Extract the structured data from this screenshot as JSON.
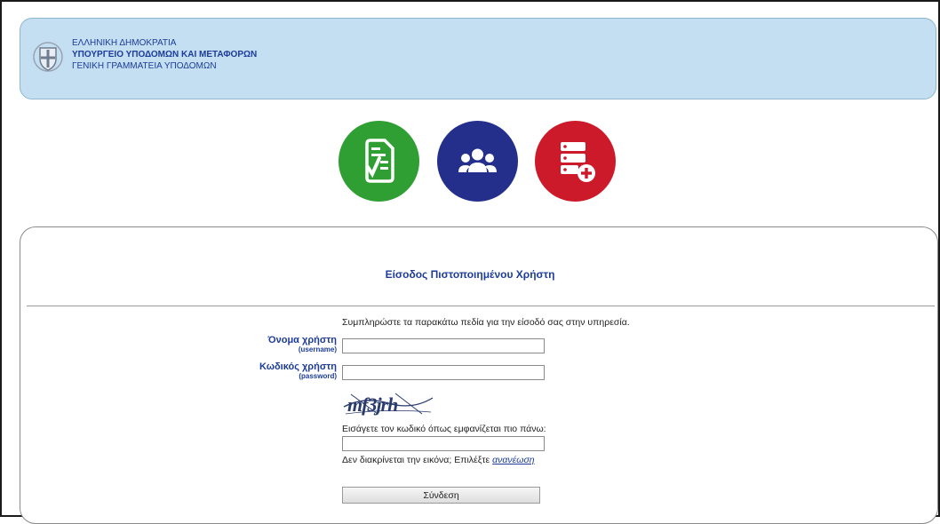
{
  "header": {
    "line1": "ΕΛΛΗΝΙΚΗ ΔΗΜΟΚΡΑΤΙΑ",
    "line2": "ΥΠΟΥΡΓΕΙΟ ΥΠΟΔΟΜΩΝ ΚΑΙ ΜΕΤΑΦΟΡΩΝ",
    "line3": "ΓΕΝΙΚΗ ΓΡΑΜΜΑΤΕΙΑ ΥΠΟΔΟΜΩΝ"
  },
  "shortcuts": [
    {
      "icon": "checklist-document-icon",
      "color": "#2f9e33"
    },
    {
      "icon": "users-group-icon",
      "color": "#242f8c"
    },
    {
      "icon": "server-add-icon",
      "color": "#cc1a2a"
    }
  ],
  "login": {
    "title": "Είσοδος Πιστοποιημένου Χρήστη",
    "instructions": "Συμπληρώστε τα παρακάτω πεδία για την είσοδό σας στην υπηρεσία.",
    "username_label": "Όνομα χρήστη",
    "username_sub": "(username)",
    "username_value": "",
    "password_label": "Κωδικός χρήστη",
    "password_sub": "(password)",
    "password_value": "",
    "captcha_text": "mf3jrh",
    "captcha_prompt": "Εισάγετε τον κωδικό όπως εμφανίζεται πιο πάνω:",
    "captcha_value": "",
    "refresh_text": "Δεν διακρίνεται την εικόνα; Επιλέξτε",
    "refresh_link": "ανανέωση",
    "submit_label": "Σύνδεση"
  }
}
